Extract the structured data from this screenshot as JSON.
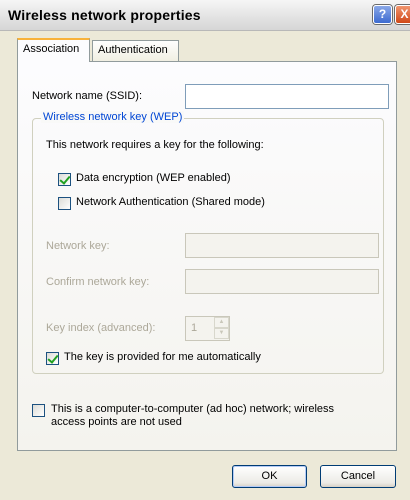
{
  "window": {
    "title": "Wireless network properties",
    "help_button": "?",
    "close_button": "X"
  },
  "tabs": [
    {
      "label": "Association",
      "active": true
    },
    {
      "label": "Authentication",
      "active": false
    }
  ],
  "association": {
    "ssid_label": "Network name (SSID):",
    "ssid_value": "",
    "wep_group_title": "Wireless network key (WEP)",
    "requires_key_text": "This network requires a key for the following:",
    "data_encryption_label": "Data encryption (WEP enabled)",
    "data_encryption_checked": true,
    "network_auth_label": "Network Authentication (Shared mode)",
    "network_auth_checked": false,
    "network_key_label": "Network key:",
    "network_key_value": "",
    "confirm_key_label": "Confirm network key:",
    "confirm_key_value": "",
    "key_index_label": "Key index (advanced):",
    "key_index_value": "1",
    "auto_key_label": "The key is provided for me automatically",
    "auto_key_checked": true,
    "adhoc_label_line1": "This is a computer-to-computer (ad hoc) network; wireless",
    "adhoc_label_line2": "access points are not used",
    "adhoc_checked": false
  },
  "buttons": {
    "ok": "OK",
    "cancel": "Cancel"
  },
  "colors": {
    "accent_tab": "#f8b23a",
    "group_title": "#0046d5",
    "check_mark": "#21a121"
  }
}
